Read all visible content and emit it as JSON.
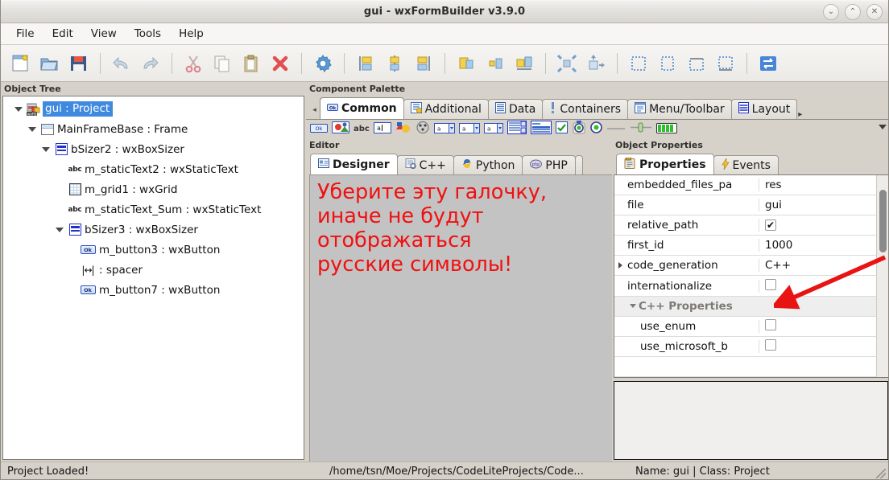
{
  "window": {
    "title": "gui - wxFormBuilder v3.9.0",
    "controls": [
      {
        "name": "minimize-button",
        "glyph": "⌄"
      },
      {
        "name": "maximize-button",
        "glyph": "⌃"
      },
      {
        "name": "close-button",
        "glyph": "✕"
      }
    ]
  },
  "menubar": {
    "items": [
      "File",
      "Edit",
      "View",
      "Tools",
      "Help"
    ]
  },
  "toolbar": {
    "groups": [
      [
        "new-icon",
        "open-icon",
        "save-icon"
      ],
      [
        "undo-icon",
        "redo-icon"
      ],
      [
        "cut-icon",
        "copy-icon",
        "paste-icon",
        "delete-icon"
      ],
      [
        "settings-icon"
      ],
      [
        "align-left-icon",
        "align-center-h-icon",
        "align-right-icon"
      ],
      [
        "align-top-icon",
        "align-center-v-icon",
        "align-bottom-icon"
      ],
      [
        "expand-icon",
        "stretch-icon"
      ],
      [
        "border-left-icon",
        "border-all-icon",
        "border-top-icon",
        "border-none-icon"
      ],
      [
        "swap-icon"
      ]
    ]
  },
  "object_tree": {
    "header": "Object Tree",
    "nodes": [
      {
        "label": "gui : Project",
        "icon": "project-icon",
        "indent": 0,
        "expander": "down",
        "selected": true
      },
      {
        "label": "MainFrameBase : Frame",
        "icon": "frame-icon",
        "indent": 1,
        "expander": "down",
        "selected": false
      },
      {
        "label": "bSizer2 : wxBoxSizer",
        "icon": "sizer-icon",
        "indent": 2,
        "expander": "down",
        "selected": false
      },
      {
        "label": "m_staticText2 : wxStaticText",
        "icon": "abc-icon",
        "indent": 3,
        "expander": "none",
        "selected": false
      },
      {
        "label": "m_grid1 : wxGrid",
        "icon": "grid-icon",
        "indent": 3,
        "expander": "none",
        "selected": false
      },
      {
        "label": "m_staticText_Sum : wxStaticText",
        "icon": "abc-icon",
        "indent": 3,
        "expander": "none",
        "selected": false
      },
      {
        "label": "bSizer3 : wxBoxSizer",
        "icon": "sizer-icon",
        "indent": 3,
        "expander": "down",
        "selected": false
      },
      {
        "label": "m_button3 : wxButton",
        "icon": "button-icon",
        "indent": 4,
        "expander": "none",
        "selected": false
      },
      {
        "label": ": spacer",
        "icon": "spacer-icon",
        "indent": 4,
        "expander": "none",
        "selected": false
      },
      {
        "label": "m_button7 : wxButton",
        "icon": "button-icon",
        "indent": 4,
        "expander": "none",
        "selected": false
      }
    ]
  },
  "component_palette": {
    "header": "Component Palette",
    "scroll_left": "◂",
    "scroll_right": "▸",
    "tabs": [
      {
        "label": "Common",
        "icon": "button-small-icon",
        "active": true
      },
      {
        "label": "Additional",
        "icon": "additional-icon",
        "active": false
      },
      {
        "label": "Data",
        "icon": "data-icon",
        "active": false
      },
      {
        "label": "Containers",
        "icon": "containers-icon",
        "active": false
      },
      {
        "label": "Menu/Toolbar",
        "icon": "menu-toolbar-icon",
        "active": false
      },
      {
        "label": "Layout",
        "icon": "layout-icon",
        "active": false
      }
    ],
    "widget_icons": [
      "wxbutton-icon",
      "wxbitmapbutton-icon",
      "wxstatictext-icon",
      "wxtextctrl-icon",
      "wxstaticbitmap-icon",
      "wxcombobox-icon",
      "wxchoice-icon",
      "wxcombo-icon",
      "wxspin-icon",
      "wxlistbox-icon",
      "wxlistctrl-icon",
      "wxcheckbox-icon",
      "wxradiobutton-icon",
      "wxradio2-icon",
      "wxstaticline-icon",
      "wxslider-icon",
      "wxgauge-icon"
    ],
    "overflow": "dropdown-icon"
  },
  "editor": {
    "header": "Editor",
    "tabs": [
      {
        "label": "Designer",
        "icon": "designer-icon",
        "active": true
      },
      {
        "label": "C++",
        "icon": "cpp-icon",
        "active": false
      },
      {
        "label": "Python",
        "icon": "python-icon",
        "active": false
      },
      {
        "label": "PHP",
        "icon": "php-icon",
        "active": false
      }
    ],
    "canvas_note": "Уберите эту галочку,\nиначе не будут\nотображаться\nрусские символы!",
    "canvas_note_color": "#f01010",
    "canvas_bg": "#c3c3c3"
  },
  "object_properties": {
    "header": "Object Properties",
    "tabs": [
      {
        "label": "Properties",
        "icon": "properties-icon",
        "active": true
      },
      {
        "label": "Events",
        "icon": "events-icon",
        "active": false
      }
    ],
    "rows": [
      {
        "name": "embedded_files_pa",
        "value": "res",
        "type": "text",
        "expander": "none",
        "category": false
      },
      {
        "name": "file",
        "value": "gui",
        "type": "text",
        "expander": "none",
        "category": false
      },
      {
        "name": "relative_path",
        "value": "",
        "type": "checkbox",
        "checked": true,
        "expander": "none",
        "category": false
      },
      {
        "name": "first_id",
        "value": "1000",
        "type": "text",
        "expander": "none",
        "category": false
      },
      {
        "name": "code_generation",
        "value": "C++",
        "type": "text",
        "expander": "right",
        "category": false
      },
      {
        "name": "internationalize",
        "value": "",
        "type": "checkbox",
        "checked": false,
        "expander": "none",
        "category": false
      },
      {
        "name": "C++ Properties",
        "value": "",
        "type": "none",
        "expander": "down",
        "category": true
      },
      {
        "name": "use_enum",
        "value": "",
        "type": "checkbox",
        "checked": false,
        "expander": "none",
        "category": false
      },
      {
        "name": "use_microsoft_b",
        "value": "",
        "type": "checkbox",
        "checked": false,
        "expander": "none",
        "category": false
      }
    ]
  },
  "annotation": {
    "arrow_name": "red-arrow-pointing-to-internationalize",
    "color": "#e81414"
  },
  "statusbar": {
    "message": "Project Loaded!",
    "path": "/home/tsn/Moe/Projects/CodeLiteProjects/Code...",
    "selection": "Name: gui | Class: Project"
  }
}
